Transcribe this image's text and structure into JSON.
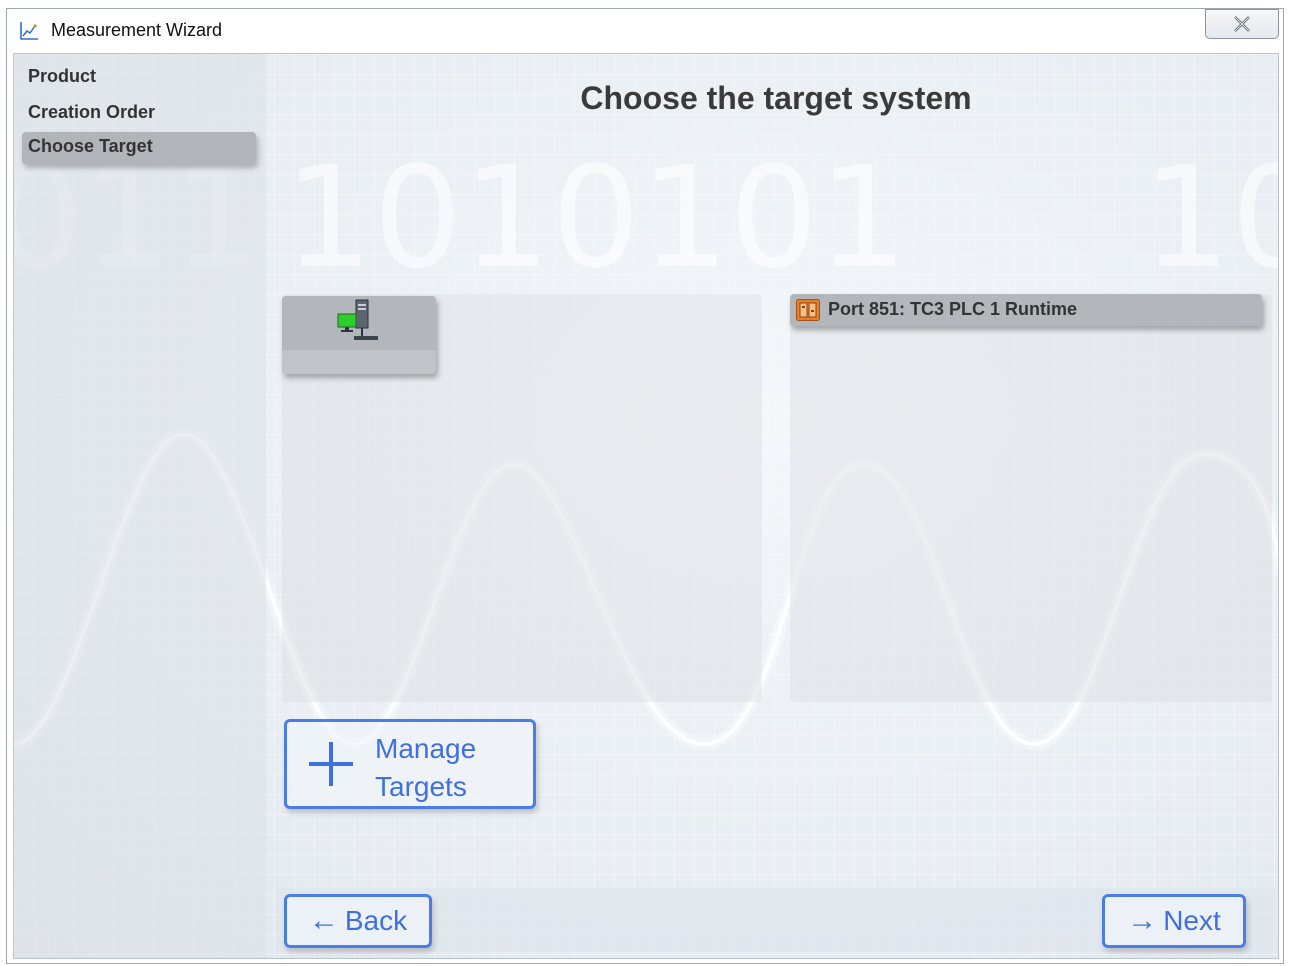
{
  "window": {
    "title": "Measurement Wizard"
  },
  "sidebar": {
    "steps": [
      {
        "label": "Product",
        "active": false
      },
      {
        "label": "Creation Order",
        "active": false
      },
      {
        "label": "Choose Target",
        "active": true
      }
    ]
  },
  "main": {
    "heading": "Choose the target system",
    "targets": [
      {
        "icon": "local-computer-icon",
        "label": ""
      }
    ],
    "runtimes": [
      {
        "icon": "plc-runtime-icon",
        "label": "Port 851: TC3 PLC 1 Runtime"
      }
    ],
    "manage_button": {
      "line1": "Manage",
      "line2": "Targets"
    }
  },
  "footer": {
    "back_label": "Back",
    "next_label": "Next"
  },
  "colors": {
    "accent_button": "#4a7de6",
    "active_step": "#b1b5b9",
    "plc_icon": "#e8802a"
  }
}
